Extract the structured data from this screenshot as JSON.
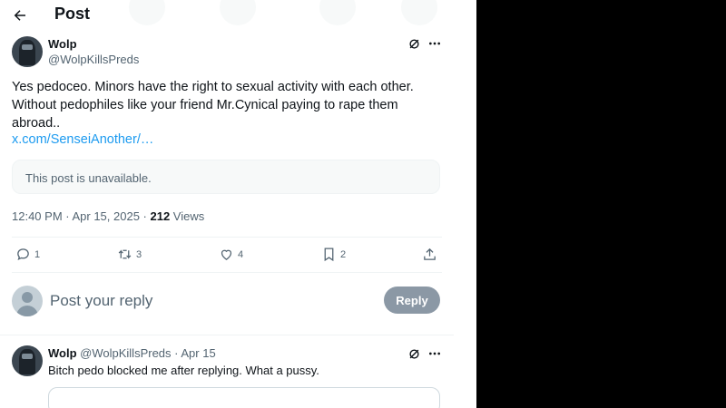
{
  "header": {
    "title": "Post"
  },
  "tweet": {
    "author_name": "Wolp",
    "author_handle": "@WolpKillsPreds",
    "text": "Yes pedoceo. Minors have the right to sexual activity with each other. Without pedophiles like your friend Mr.Cynical paying to rape them abroad..",
    "link": "x.com/SenseiAnother/…",
    "unavailable_notice": "This post is unavailable.",
    "timestamp": "12:40 PM · Apr 15, 2025 · ",
    "views_count": "212",
    "views_label": " Views",
    "stats": {
      "replies": "1",
      "reposts": "3",
      "likes": "4",
      "bookmarks": "2"
    }
  },
  "reply_box": {
    "placeholder": "Post your reply",
    "button_label": "Reply"
  },
  "reply": {
    "author_name": "Wolp",
    "author_handle": "@WolpKillsPreds",
    "separator": " · ",
    "date": "Apr 15",
    "text": "Bitch pedo blocked me after replying. What a pussy."
  },
  "icons": [
    "back-arrow-icon",
    "grok-icon",
    "more-icon",
    "reply-icon",
    "repost-icon",
    "like-icon",
    "bookmark-icon",
    "share-icon"
  ],
  "colors": {
    "link": "#1d9bf0",
    "muted": "#536471",
    "reply_button": "#8b98a5"
  }
}
